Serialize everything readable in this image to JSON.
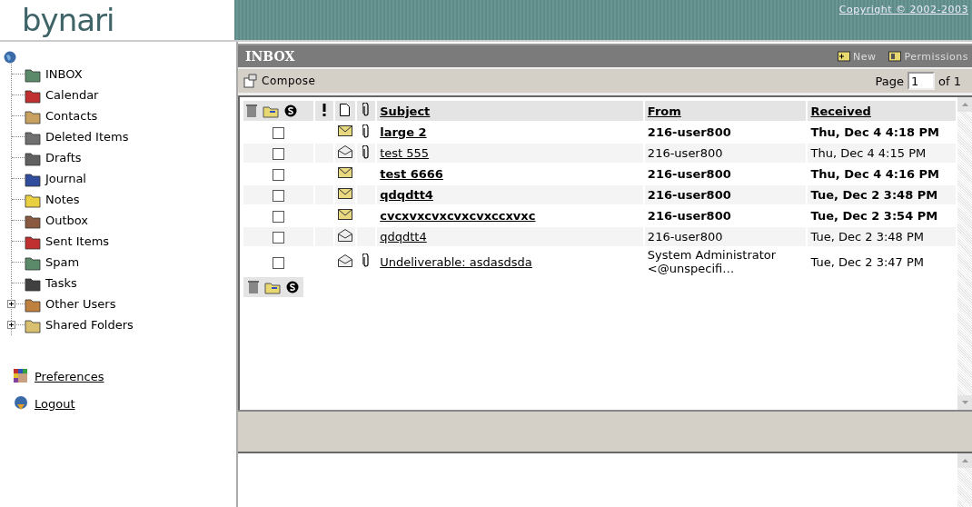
{
  "header": {
    "logo": "bynari",
    "copyright": "Copyright © 2002-2003"
  },
  "sidebar": {
    "items": [
      {
        "label": "INBOX",
        "selected": false
      },
      {
        "label": "Calendar",
        "selected": false
      },
      {
        "label": "Contacts",
        "selected": false
      },
      {
        "label": "Deleted Items",
        "selected": false
      },
      {
        "label": "Drafts",
        "selected": false
      },
      {
        "label": "Journal",
        "selected": false
      },
      {
        "label": "Notes",
        "selected": false
      },
      {
        "label": "Outbox",
        "selected": false
      },
      {
        "label": "Sent Items",
        "selected": false
      },
      {
        "label": "Spam",
        "selected": false
      },
      {
        "label": "Tasks",
        "selected": false
      },
      {
        "label": "Other Users",
        "selected": false,
        "expanded": false
      },
      {
        "label": "Shared Folders",
        "selected": false,
        "expanded": false
      }
    ],
    "links": [
      "Preferences",
      "Logout"
    ]
  },
  "folder": {
    "title": "INBOX",
    "actions": [
      "New",
      "Permissions"
    ]
  },
  "toolbar": {
    "compose": "Compose",
    "page_label": "Page",
    "page": "1",
    "page_total": "of 1"
  },
  "table": {
    "columns": [
      "Subject",
      "From",
      "Received"
    ],
    "rows": [
      {
        "checked": false,
        "unread": true,
        "attachment": true,
        "subject": "large 2",
        "from": "216-user800",
        "received": "Thu, Dec 4 4:18 PM"
      },
      {
        "checked": false,
        "unread": false,
        "attachment": true,
        "subject": "test 555",
        "from": "216-user800",
        "received": "Thu, Dec 4 4:15 PM"
      },
      {
        "checked": false,
        "unread": true,
        "attachment": false,
        "subject": "test 6666",
        "from": "216-user800",
        "received": "Thu, Dec 4 4:16 PM"
      },
      {
        "checked": false,
        "unread": true,
        "attachment": false,
        "subject": "qdqdtt4",
        "from": "216-user800",
        "received": "Tue, Dec 2 3:48 PM"
      },
      {
        "checked": false,
        "unread": true,
        "attachment": false,
        "subject": "cvcxvxcvxcvxcvxccxvxc",
        "from": "216-user800",
        "received": "Tue, Dec 2 3:54 PM"
      },
      {
        "checked": false,
        "unread": false,
        "attachment": false,
        "subject": "qdqdtt4",
        "from": "216-user800",
        "received": "Tue, Dec 2 3:48 PM"
      },
      {
        "checked": false,
        "unread": false,
        "attachment": true,
        "subject": "Undeliverable: asdasdsda",
        "from": "System Administrator <@unspecifi…",
        "received": "Tue, Dec 2 3:47 PM"
      }
    ]
  }
}
